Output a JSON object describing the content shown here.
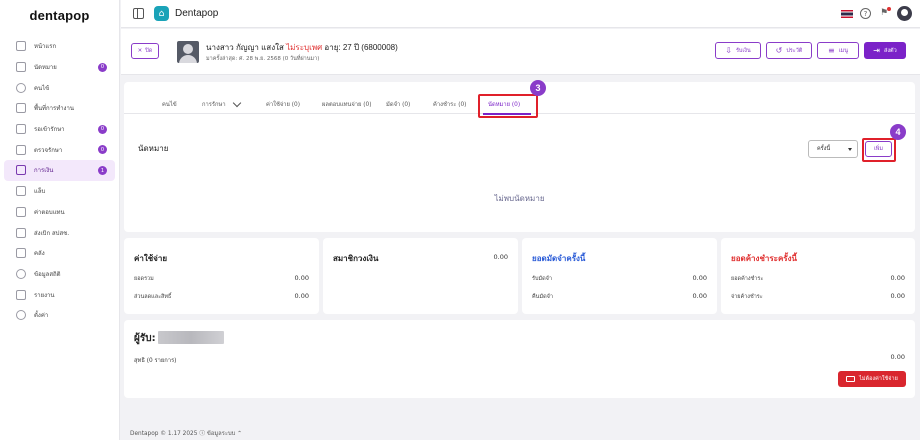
{
  "app": {
    "logo": "dentapop",
    "title": "Dentapop"
  },
  "sidebar": {
    "items": [
      {
        "label": "หน้าแรก",
        "icon": "home-icon"
      },
      {
        "label": "นัดหมาย",
        "icon": "calendar-icon",
        "badge": "0"
      },
      {
        "label": "คนไข้",
        "icon": "user-icon"
      },
      {
        "label": "พื้นที่การทำงาน",
        "icon": "workspace-icon"
      },
      {
        "label": "รอเข้ารักษา",
        "icon": "waiting-room-icon",
        "badge": "0"
      },
      {
        "label": "ตรวจรักษา",
        "icon": "treatment-icon",
        "badge": "0"
      },
      {
        "label": "การเงิน",
        "icon": "finance-icon",
        "badge": "1",
        "active": true
      },
      {
        "label": "แล็บ",
        "icon": "lab-icon"
      },
      {
        "label": "ค่าตอบแทน",
        "icon": "percent-icon"
      },
      {
        "label": "ส่งเบิก สปสช.",
        "icon": "cloud-icon"
      },
      {
        "label": "คลัง",
        "icon": "inventory-icon"
      },
      {
        "label": "ข้อมูลสถิติ",
        "icon": "stats-icon"
      },
      {
        "label": "รายงาน",
        "icon": "report-icon"
      },
      {
        "label": "ตั้งค่า",
        "icon": "settings-icon"
      }
    ]
  },
  "patient": {
    "close_label": "ปิด",
    "name": "นางสาว กัญญา แสงใส",
    "gender": "ไม่ระบุเพศ",
    "age": "อายุ: 27 ปี",
    "hn": "(6800008)",
    "last_visit": "มาครั้งล่าสุด: ศ. 28 พ.ย. 2568 (0 วันที่ผ่านมา)"
  },
  "header_buttons": {
    "receive": "รับเงิน",
    "history": "ประวัติ",
    "menu": "เมนู",
    "send": "ส่งตัว"
  },
  "tabs": [
    {
      "label": "คนไข้"
    },
    {
      "label": "การรักษา"
    },
    {
      "label": "ค่าใช้จ่าย (0)"
    },
    {
      "label": "ผลตอบแทนจ่าย (0)"
    },
    {
      "label": "มัดจำ (0)"
    },
    {
      "label": "ค้างชำระ (0)"
    },
    {
      "label": "นัดหมาย (0)",
      "active": true
    }
  ],
  "steps": {
    "tab": "3",
    "add": "4"
  },
  "appointments": {
    "title": "นัดหมาย",
    "filter_value": "ครั้งนี้",
    "add_label": "เพิ่ม",
    "empty_text": "ไม่พบนัดหมาย"
  },
  "summary": {
    "expense": {
      "title": "ค่าใช้จ่าย",
      "total_label": "ยอดรวม",
      "total": "0.00",
      "discount_label": "ส่วนลดและสิทธิ์",
      "discount": "0.00"
    },
    "membership": {
      "title": "สมาชิกวงเงิน",
      "value": "0.00"
    },
    "deposit": {
      "title": "ยอดมัดจำครั้งนี้",
      "receive_label": "รับมัดจำ",
      "receive": "0.00",
      "refund_label": "คืนมัดจำ",
      "refund": "0.00"
    },
    "outstanding": {
      "title": "ยอดค้างชำระครั้งนี้",
      "owed_label": "ยอดค้างชำระ",
      "owed": "0.00",
      "paid_label": "จ่ายค้างชำระ",
      "paid": "0.00"
    }
  },
  "receiver": {
    "label": "ผู้รับ:",
    "net_label": "สุทธิ (0 รายการ)",
    "net_value": "0.00",
    "print_label": "ไม่ต้องค่าใช้จ่าย"
  },
  "footer": {
    "text": "Dentapop © 1.17 2025",
    "info": "ⓘ ข้อมูลระบบ ⌃"
  },
  "colors": {
    "accent": "#7b22c8",
    "highlight": "#e0202a",
    "deposit_title": "#2a5bd7",
    "outstanding_title": "#e03131"
  }
}
